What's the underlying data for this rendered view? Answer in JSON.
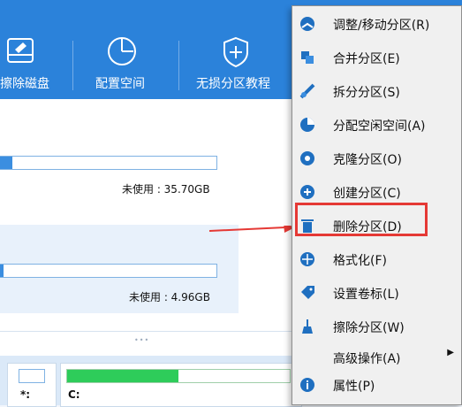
{
  "toolbar": {
    "buttons": [
      {
        "label": "擦除磁盘",
        "icon": "disk-erase-icon"
      },
      {
        "label": "配置空间",
        "icon": "clock-pie-icon"
      },
      {
        "label": "无损分区教程",
        "icon": "shield-plus-icon"
      }
    ]
  },
  "partitions": [
    {
      "free_text": "未使用 : 35.70GB",
      "usage_fraction": 0.06
    },
    {
      "free_text": "未使用 : 4.96GB",
      "usage_fraction": 0.02
    }
  ],
  "bottom": {
    "disk1_label": "*:",
    "disk2_label": "C:",
    "disk2_usage_fraction": 0.5
  },
  "context_menu": {
    "items": [
      {
        "label": "调整/移动分区(R)",
        "icon": "resize-move-icon"
      },
      {
        "label": "合并分区(E)",
        "icon": "merge-icon"
      },
      {
        "label": "拆分分区(S)",
        "icon": "split-icon"
      },
      {
        "label": "分配空闲空间(A)",
        "icon": "allocate-space-icon"
      },
      {
        "label": "克隆分区(O)",
        "icon": "clone-icon"
      },
      {
        "label": "创建分区(C)",
        "icon": "create-partition-icon"
      },
      {
        "label": "删除分区(D)",
        "icon": "trash-icon"
      },
      {
        "label": "格式化(F)",
        "icon": "format-icon"
      },
      {
        "label": "设置卷标(L)",
        "icon": "tag-icon"
      },
      {
        "label": "擦除分区(W)",
        "icon": "broom-icon"
      },
      {
        "label": "高级操作(A)",
        "icon": "none"
      },
      {
        "label": "属性(P)",
        "icon": "info-icon"
      }
    ]
  },
  "colors": {
    "toolbar": "#2b82da",
    "accent": "#3b8ee0",
    "highlight_box": "#e53935",
    "usage_green": "#2ecc5a"
  }
}
